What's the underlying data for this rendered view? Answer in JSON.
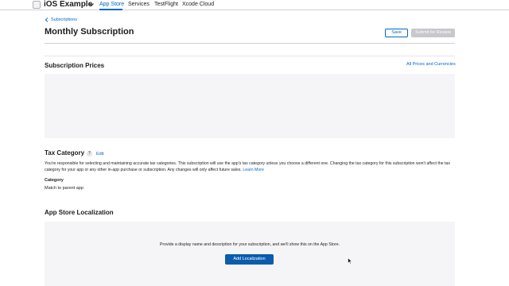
{
  "nav": {
    "app_name": "iOS Example",
    "tabs": [
      "App Store",
      "Services",
      "TestFlight",
      "Xcode Cloud"
    ],
    "active_tab": "App Store",
    "accent_color": "#0066cc"
  },
  "header": {
    "breadcrumb": "Subscriptions",
    "title": "Monthly Subscription",
    "save_label": "Save",
    "submit_label": "Submit for Review"
  },
  "prices": {
    "title": "Subscription Prices",
    "link": "All Prices and Currencies"
  },
  "tax": {
    "title": "Tax Category",
    "help_glyph": "?",
    "edit_label": "Edit",
    "description": "You're responsible for selecting and maintaining accurate tax categories. This subscription will use the app's tax category unless you choose a different one. Changing the tax category for this subscription won't affect the tax category for your app or any other in-app purchase or subscription. Any changes will only affect future sales.",
    "learn_more": "Learn More",
    "category_label": "Category",
    "category_value": "Match to parent app"
  },
  "localization": {
    "title": "App Store Localization",
    "empty_text": "Provide a display name and description for your subscription, and we'll show this on the App Store.",
    "add_button": "Add Localization"
  }
}
